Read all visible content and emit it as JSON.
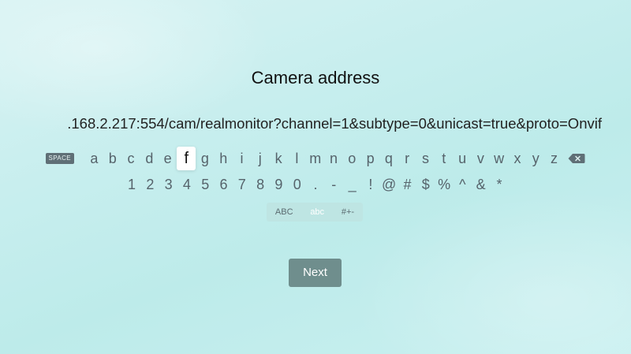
{
  "screen": {
    "title": "Camera address",
    "address_value": ".168.2.217:554/cam/realmonitor?channel=1&subtype=0&unicast=true&proto=Onvif"
  },
  "keyboard": {
    "space_label": "SPACE",
    "letters": [
      "a",
      "b",
      "c",
      "d",
      "e",
      "f",
      "g",
      "h",
      "i",
      "j",
      "k",
      "l",
      "m",
      "n",
      "o",
      "p",
      "q",
      "r",
      "s",
      "t",
      "u",
      "v",
      "w",
      "x",
      "y",
      "z"
    ],
    "selected_key": "f",
    "symbols": [
      "1",
      "2",
      "3",
      "4",
      "5",
      "6",
      "7",
      "8",
      "9",
      "0",
      ".",
      "-",
      "_",
      "!",
      "@",
      "#",
      "$",
      "%",
      "^",
      "&",
      "*"
    ],
    "modes": [
      "ABC",
      "abc",
      "#+-"
    ],
    "active_mode": "abc",
    "delete_icon": "backspace-icon"
  },
  "actions": {
    "next_label": "Next"
  },
  "colors": {
    "background": "#c7eeee",
    "key_text": "#56636b",
    "selected_key_bg": "#ffffff",
    "next_button_bg": "#6f8e8d",
    "space_key_bg": "#5f6f76"
  }
}
